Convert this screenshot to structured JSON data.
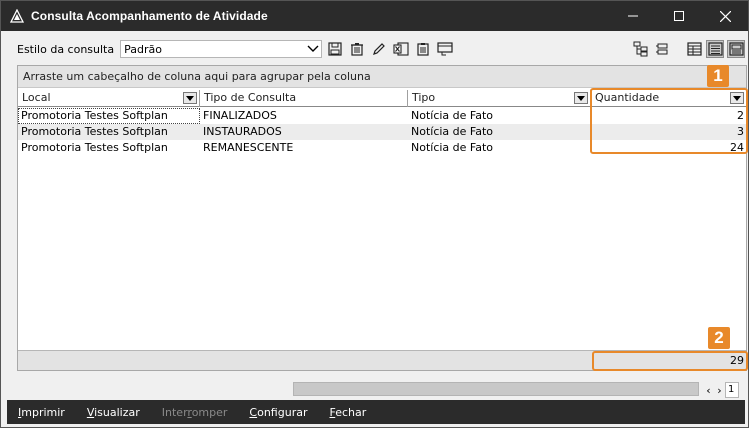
{
  "window": {
    "title": "Consulta Acompanhamento de Atividade",
    "controls": [
      "minimize",
      "maximize",
      "close"
    ]
  },
  "stylebar": {
    "label": "Estilo da consulta",
    "selected": "Padrão",
    "left_icons": [
      "save-icon",
      "delete-icon",
      "edit-icon",
      "export-excel-icon",
      "clipboard-icon",
      "layout-icon"
    ],
    "right_icons": [
      "tree-icon",
      "collapse-icon",
      "grid-icon",
      "details-icon",
      "preview-icon"
    ]
  },
  "grid": {
    "group_hint": "Arraste um cabeçalho de coluna aqui para agrupar pela coluna",
    "columns": [
      "Local",
      "Tipo de Consulta",
      "Tipo",
      "Quantidade"
    ],
    "rows": [
      {
        "local": "Promotoria Testes Softplan",
        "tipo_consulta": "FINALIZADOS",
        "tipo": "Notícia de Fato",
        "quantidade": "2"
      },
      {
        "local": "Promotoria Testes Softplan",
        "tipo_consulta": "INSTAURADOS",
        "tipo": "Notícia de Fato",
        "quantidade": "3"
      },
      {
        "local": "Promotoria Testes Softplan",
        "tipo_consulta": "REMANESCENTE",
        "tipo": "Notícia de Fato",
        "quantidade": "24"
      }
    ],
    "total": "29"
  },
  "callouts": {
    "first": "1",
    "second": "2",
    "color": "#e8892a"
  },
  "pager": {
    "page": "1"
  },
  "actions": {
    "print": {
      "pre": "",
      "key": "I",
      "post": "mprimir"
    },
    "view": {
      "pre": "",
      "key": "V",
      "post": "isualizar"
    },
    "interrupt": {
      "pre": "Inter",
      "key": "r",
      "post": "omper"
    },
    "configure": {
      "pre": "",
      "key": "C",
      "post": "onfigurar"
    },
    "close": {
      "pre": "",
      "key": "F",
      "post": "echar"
    }
  }
}
